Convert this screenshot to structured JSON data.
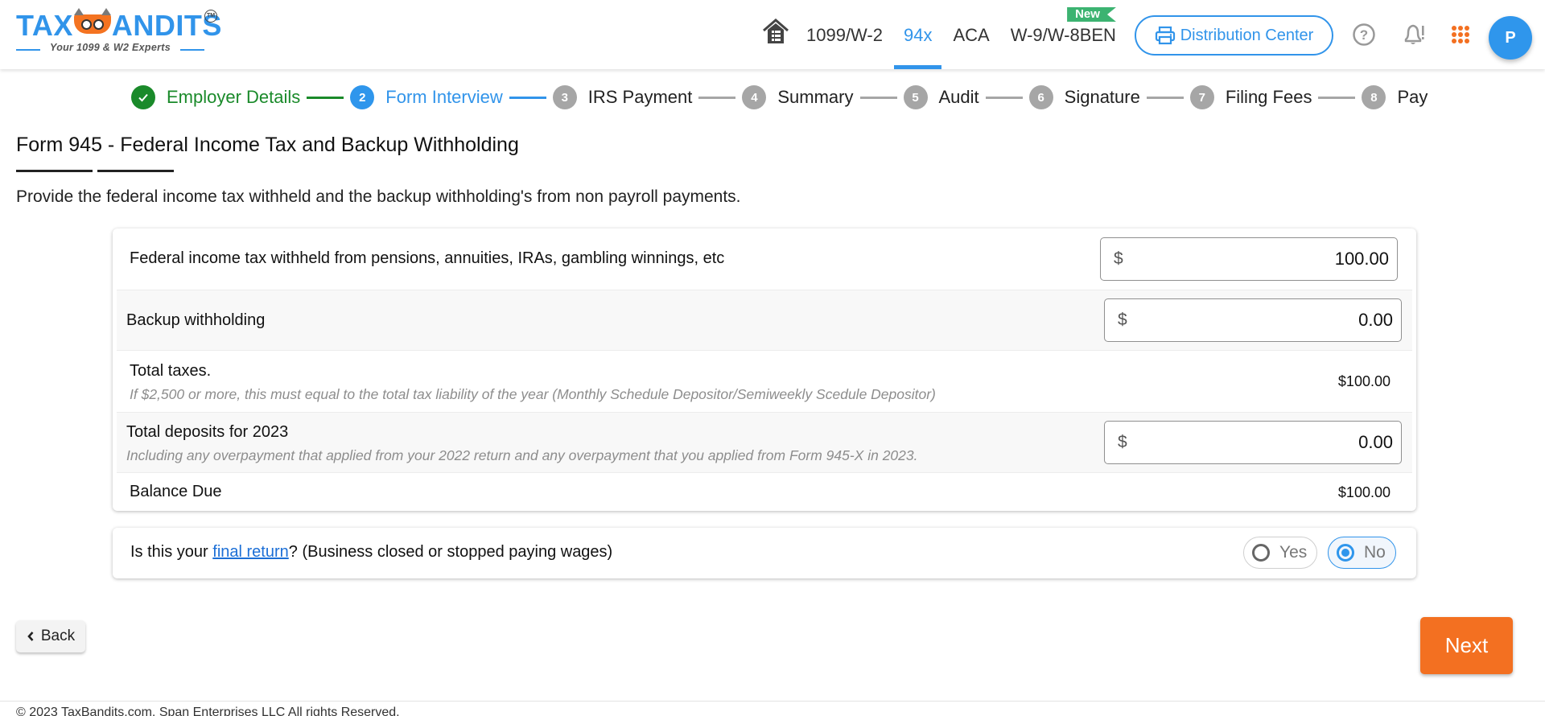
{
  "header": {
    "logo": {
      "brand": "TAXBANDITS",
      "brand_left": "TAX",
      "brand_right": "ANDITS",
      "tm": "TM",
      "tagline": "Your 1099 & W2 Experts"
    },
    "nav": [
      {
        "label": "1099/W-2",
        "active": false
      },
      {
        "label": "94x",
        "active": true
      },
      {
        "label": "ACA",
        "active": false
      },
      {
        "label": "W-9/W-8BEN",
        "active": false,
        "badge": "New"
      }
    ],
    "distribution_center": "Distribution Center",
    "icons": [
      "home-icon",
      "printer-icon",
      "help-icon",
      "notification-bell-icon",
      "apps-grid-icon"
    ],
    "avatar_initial": "P",
    "colors": {
      "brand_blue": "#3194ea",
      "accent_orange": "#f37021",
      "new_badge": "#3cb371"
    }
  },
  "stepper": [
    {
      "number": "1",
      "label": "Employer Details",
      "state": "done"
    },
    {
      "number": "2",
      "label": "Form Interview",
      "state": "active"
    },
    {
      "number": "3",
      "label": "IRS Payment",
      "state": "pending"
    },
    {
      "number": "4",
      "label": "Summary",
      "state": "pending"
    },
    {
      "number": "5",
      "label": "Audit",
      "state": "pending"
    },
    {
      "number": "6",
      "label": "Signature",
      "state": "pending"
    },
    {
      "number": "7",
      "label": "Filing Fees",
      "state": "pending"
    },
    {
      "number": "8",
      "label": "Pay",
      "state": "pending"
    }
  ],
  "page": {
    "title": "Form 945 - Federal Income Tax and Backup Withholding",
    "description": "Provide the federal income tax withheld and the backup withholding's from non payroll payments."
  },
  "form": {
    "currency_symbol": "$",
    "federal_tax": {
      "label": "Federal income tax withheld from pensions, annuities, IRAs, gambling winnings, etc",
      "value": "100.00"
    },
    "backup_withholding": {
      "label": "Backup withholding",
      "value": "0.00"
    },
    "total_taxes": {
      "label": "Total taxes.",
      "hint": "If $2,500 or more, this must equal to the total tax liability of the year (Monthly Schedule Depositor/Semiweekly Scedule Depositor)",
      "value": "$100.00"
    },
    "total_deposits": {
      "label": "Total deposits for 2023",
      "hint": "Including any overpayment that applied from your 2022 return and any overpayment that you applied from Form 945-X in 2023.",
      "value": "0.00"
    },
    "balance_due": {
      "label": "Balance Due",
      "value": "$100.00"
    }
  },
  "final_return": {
    "prefix": "Is this your ",
    "link": "final return",
    "suffix": "? (Business closed or stopped paying wages)",
    "options": [
      {
        "label": "Yes",
        "checked": false
      },
      {
        "label": "No",
        "checked": true
      }
    ]
  },
  "actions": {
    "back": "Back",
    "next": "Next"
  },
  "footer": {
    "copyright": "© 2023 TaxBandits.com, Span Enterprises LLC All rights Reserved."
  }
}
